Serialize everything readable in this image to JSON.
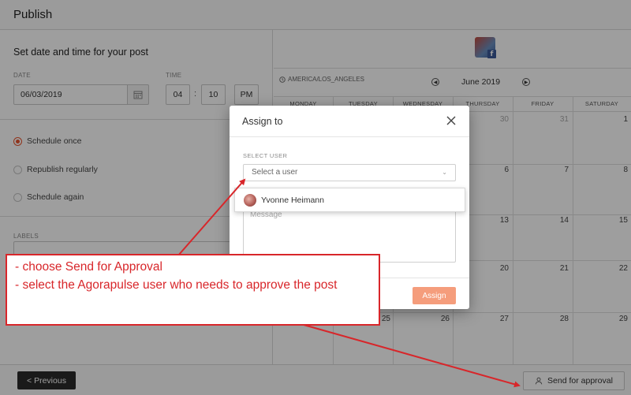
{
  "header": {
    "title": "Publish"
  },
  "schedule": {
    "section_title": "Set date and time for your post",
    "date_label": "DATE",
    "date_value": "06/03/2019",
    "time_label": "TIME",
    "hour": "04",
    "minute": "10",
    "ampm": "PM",
    "options": [
      {
        "label": "Schedule once",
        "selected": true
      },
      {
        "label": "Republish regularly",
        "selected": false
      },
      {
        "label": "Schedule again",
        "selected": false
      }
    ],
    "labels_label": "LABELS"
  },
  "calendar": {
    "timezone": "AMERICA/LOS_ANGELES",
    "month": "June 2019",
    "days_of_week": [
      "MONDAY",
      "TUESDAY",
      "WEDNESDAY",
      "THURSDAY",
      "FRIDAY",
      "SATURDAY"
    ],
    "visible_dates": {
      "row1": [
        "30",
        "31",
        "1"
      ],
      "row2": [
        "6",
        "7",
        "8"
      ],
      "row3": [
        "13",
        "14",
        "15"
      ],
      "row4": [
        "20",
        "21",
        "22"
      ],
      "row5": [
        "25",
        "26",
        "27",
        "28",
        "29"
      ]
    }
  },
  "modal": {
    "title": "Assign to",
    "select_label": "SELECT USER",
    "select_placeholder": "Select a user",
    "message_placeholder": "Message",
    "assign_label": "Assign",
    "dropdown_user": "Yvonne Heimann"
  },
  "footer": {
    "previous_label": "< Previous",
    "approval_label": "Send for approval"
  },
  "annotation": {
    "line1": "- choose Send for Approval",
    "line2": "- select the Agorapulse user who needs to approve the post"
  },
  "colors": {
    "accent": "#e8542e",
    "assign_button": "#f59d7c",
    "annotation_red": "#d8262a",
    "previous_button": "#2b2b2b"
  }
}
